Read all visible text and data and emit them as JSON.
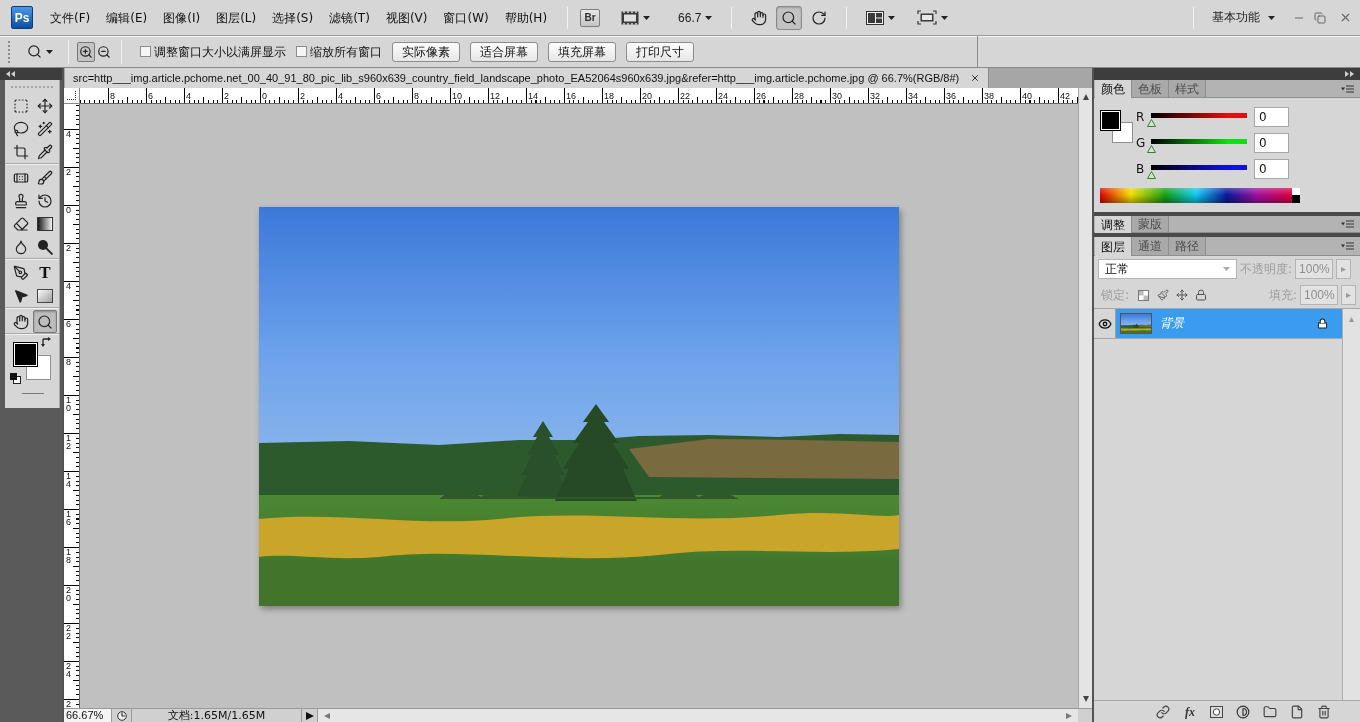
{
  "app": {
    "logo": "Ps"
  },
  "menu_bar": {
    "items": [
      "文件(F)",
      "编辑(E)",
      "图像(I)",
      "图层(L)",
      "选择(S)",
      "滤镜(T)",
      "视图(V)",
      "窗口(W)",
      "帮助(H)"
    ],
    "bridge": "Br",
    "zoom_value": "66.7",
    "view_tools": [
      {
        "kind": "hand",
        "selected": false
      },
      {
        "kind": "zoom",
        "selected": true
      },
      {
        "kind": "rotate",
        "selected": false
      }
    ],
    "workspace": "基本功能"
  },
  "options_bar": {
    "zoom_modes": [
      {
        "kind": "zoom-in",
        "selected": true
      },
      {
        "kind": "zoom-out",
        "selected": false
      }
    ],
    "checkboxes": [
      {
        "label": "调整窗口大小以满屏显示",
        "checked": false
      },
      {
        "label": "缩放所有窗口",
        "checked": false
      }
    ],
    "buttons": [
      "实际像素",
      "适合屏幕",
      "填充屏幕",
      "打印尺寸"
    ]
  },
  "toolbox": {
    "groups": [
      [
        {
          "kind": "marquee",
          "selected": false
        },
        {
          "kind": "move",
          "selected": false
        },
        {
          "kind": "lasso",
          "selected": false
        },
        {
          "kind": "magic-wand",
          "selected": false
        },
        {
          "kind": "crop",
          "selected": false
        },
        {
          "kind": "eyedropper",
          "selected": false
        }
      ],
      [
        {
          "kind": "healing",
          "selected": false
        },
        {
          "kind": "brush",
          "selected": false
        },
        {
          "kind": "stamp",
          "selected": false
        },
        {
          "kind": "history-brush",
          "selected": false
        },
        {
          "kind": "eraser",
          "selected": false
        },
        {
          "kind": "gradient",
          "selected": false
        },
        {
          "kind": "blur",
          "selected": false
        },
        {
          "kind": "dodge",
          "selected": false
        }
      ],
      [
        {
          "kind": "pen",
          "selected": false
        },
        {
          "kind": "type",
          "glyph": "T",
          "selected": false
        },
        {
          "kind": "path-select",
          "selected": false
        },
        {
          "kind": "shape",
          "selected": false
        }
      ],
      [
        {
          "kind": "hand",
          "selected": false
        },
        {
          "kind": "zoom",
          "selected": true
        }
      ]
    ],
    "swatches": [
      {
        "kind": "foreground",
        "color": "#000000"
      },
      {
        "kind": "background",
        "color": "#ffffff"
      }
    ]
  },
  "document": {
    "title": "src=http___img.article.pchome.net_00_40_91_80_pic_lib_s960x639_country_field_landscape_photo_EA52064s960x639.jpg&refer=http___img.article.pchome.jpg @ 66.7%(RGB/8#)",
    "horizontal_ruler": [
      "8",
      "6",
      "4",
      "2",
      "0",
      "2",
      "4",
      "6",
      "8",
      "10",
      "12",
      "14",
      "16",
      "18",
      "20",
      "22",
      "24",
      "26",
      "28",
      "30",
      "32",
      "34",
      "36",
      "38",
      "40",
      "42"
    ],
    "vertical_ruler": [
      "4",
      "2",
      "0",
      "2",
      "4",
      "6",
      "8",
      "10",
      "12",
      "14",
      "16",
      "18",
      "20",
      "22",
      "24",
      "2"
    ],
    "zoom": "66.67%",
    "info": "文档:1.65M/1.65M"
  },
  "color_panel": {
    "tabs": [
      {
        "label": "颜色",
        "selected": true
      },
      {
        "label": "色板",
        "selected": false
      },
      {
        "label": "样式",
        "selected": false
      }
    ],
    "swatches": [
      {
        "kind": "foreground",
        "color": "#000000"
      },
      {
        "kind": "background",
        "color": "#ffffff"
      }
    ],
    "channels": [
      {
        "name": "R",
        "color": "#e01010",
        "level": 0,
        "value": "0"
      },
      {
        "name": "G",
        "color": "#10e010",
        "level": 0,
        "value": "0"
      },
      {
        "name": "B",
        "color": "#1010e0",
        "level": 0,
        "value": "0"
      }
    ]
  },
  "adjust_panel": {
    "tabs": [
      {
        "label": "调整",
        "selected": true
      },
      {
        "label": "蒙版",
        "selected": false
      }
    ]
  },
  "layers_panel": {
    "tabs": [
      {
        "label": "图层",
        "selected": true
      },
      {
        "label": "通道",
        "selected": false
      },
      {
        "label": "路径",
        "selected": false
      }
    ],
    "blend_mode": "正常",
    "opacity": {
      "label": "不透明度:",
      "value": "100%",
      "disabled": true
    },
    "lock": {
      "label": "锁定:",
      "disabled": true
    },
    "fill": {
      "label": "填充:",
      "value": "100%",
      "disabled": true
    },
    "layers": [
      {
        "name": "背景",
        "selected": true,
        "visible": true,
        "locked": true
      }
    ],
    "fx_label": "fx"
  }
}
